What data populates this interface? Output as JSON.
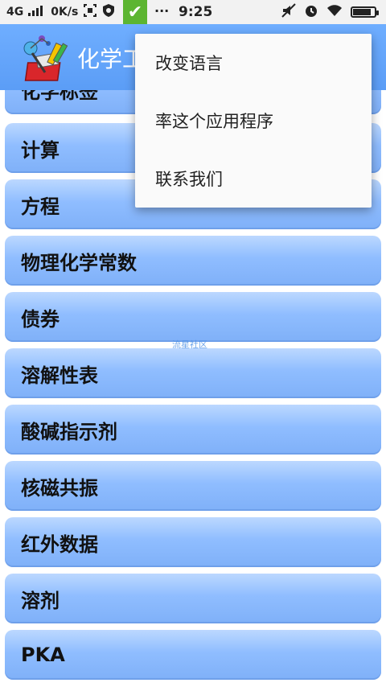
{
  "status_bar": {
    "network": "4G",
    "speed": "0K/s",
    "time": "9:25",
    "battery_percent": 85,
    "icons": [
      "signal-icon",
      "screenshot-icon",
      "shield-icon",
      "check-app-icon",
      "more-dots-icon",
      "mute-icon",
      "alarm-icon",
      "wifi-icon",
      "battery-icon"
    ]
  },
  "app_bar": {
    "title": "化学工",
    "logo": "chemistry-kit-logo"
  },
  "list": {
    "items": [
      "化学标签",
      "计算",
      "方程",
      "物理化学常数",
      "债券",
      "溶解性表",
      "酸碱指示剂",
      "核磁共振",
      "红外数据",
      "溶剂",
      "PKA"
    ]
  },
  "watermark": "流星社区",
  "menu": {
    "items": [
      "改变语言",
      "率这个应用程序",
      "联系我们"
    ]
  },
  "colors": {
    "app_bar": "#5b9df6",
    "list_item_top": "#bcd8ff",
    "list_item_bottom": "#7fb0f8",
    "menu_bg": "#fafafa",
    "status_check": "#5cb531"
  }
}
